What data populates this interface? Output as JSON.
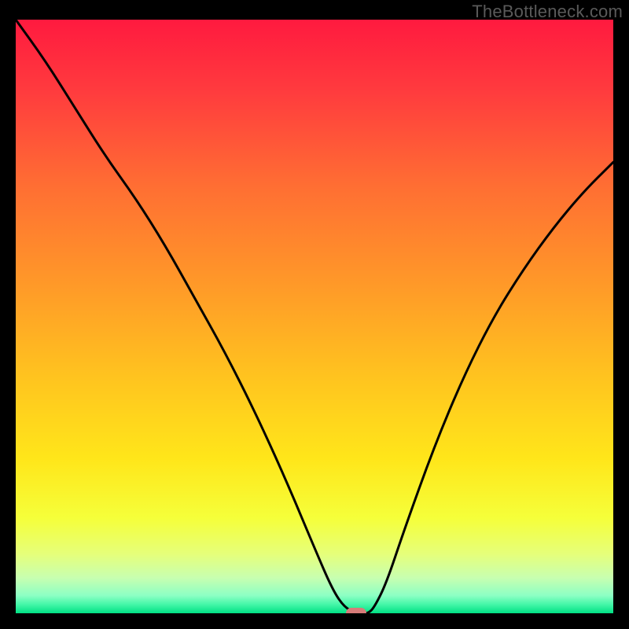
{
  "watermark": "TheBottleneck.com",
  "chart_data": {
    "type": "line",
    "title": "",
    "xlabel": "",
    "ylabel": "",
    "xlim": [
      0,
      100
    ],
    "ylim": [
      0,
      100
    ],
    "grid": false,
    "legend": false,
    "background_gradient": {
      "type": "vertical",
      "stops": [
        {
          "pos": 0.0,
          "color": "#ff1a3f"
        },
        {
          "pos": 0.12,
          "color": "#ff3b3e"
        },
        {
          "pos": 0.28,
          "color": "#ff6e33"
        },
        {
          "pos": 0.45,
          "color": "#ff9a28"
        },
        {
          "pos": 0.6,
          "color": "#ffc31f"
        },
        {
          "pos": 0.74,
          "color": "#ffe61a"
        },
        {
          "pos": 0.84,
          "color": "#f5ff3a"
        },
        {
          "pos": 0.9,
          "color": "#e6ff7a"
        },
        {
          "pos": 0.94,
          "color": "#c8ffb0"
        },
        {
          "pos": 0.97,
          "color": "#8dffc4"
        },
        {
          "pos": 0.985,
          "color": "#45f7a8"
        },
        {
          "pos": 1.0,
          "color": "#00e084"
        }
      ]
    },
    "series": [
      {
        "name": "bottleneck-curve",
        "color": "#000000",
        "x": [
          0,
          5,
          10,
          15,
          20,
          25,
          30,
          35,
          40,
          45,
          50,
          53,
          55,
          57,
          58,
          59,
          60,
          62,
          65,
          70,
          75,
          80,
          85,
          90,
          95,
          100
        ],
        "y": [
          100,
          93,
          85,
          77,
          70,
          62,
          53,
          44,
          34,
          23,
          11,
          4,
          1,
          0,
          0,
          0,
          1,
          5,
          14,
          28,
          40,
          50,
          58,
          65,
          71,
          76
        ]
      }
    ],
    "marker": {
      "name": "optimal-point",
      "x": 57,
      "y": 0,
      "color": "#d77c79"
    }
  }
}
